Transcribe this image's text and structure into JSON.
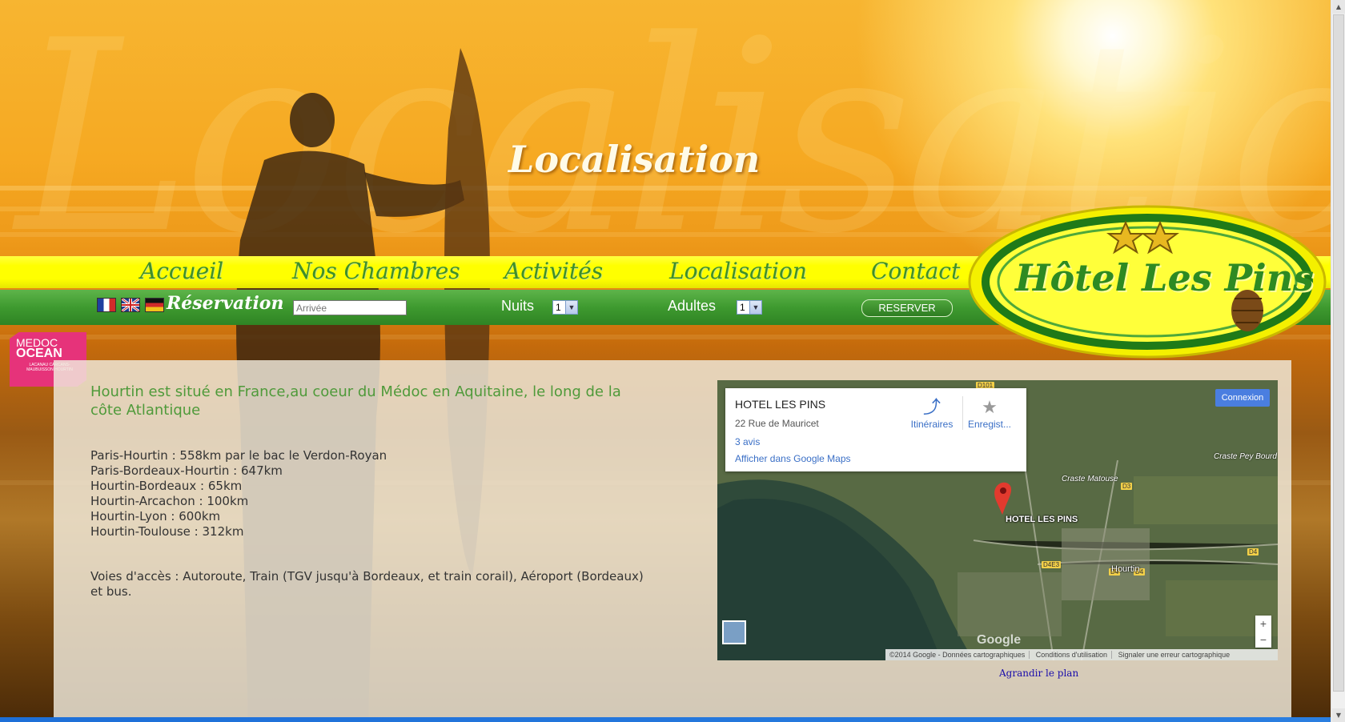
{
  "banner": {
    "title": "Localisation"
  },
  "nav": {
    "items": [
      "Accueil",
      "Nos Chambres",
      "Activités",
      "Localisation",
      "Contact"
    ]
  },
  "reservation": {
    "label": "Réservation",
    "arrival_placeholder": "Arrivée",
    "nights_label": "Nuits",
    "nights_value": "1",
    "adults_label": "Adultes",
    "adults_value": "1",
    "button": "RESERVER",
    "flags": [
      "fr-flag",
      "uk-flag",
      "de-flag"
    ]
  },
  "logo": {
    "text": "Hôtel Les Pins",
    "stars": 2
  },
  "badge": {
    "line1": "MEDOC",
    "line2": "OCEAN",
    "line3": "LACANAU CARCANS-MAUBUISSON HOURTIN"
  },
  "content": {
    "intro": "Hourtin est situé en France,au coeur du Médoc en Aquitaine, le long de la côte Atlantique",
    "distances": [
      "Paris-Hourtin : 558km par le bac le Verdon-Royan",
      "Paris-Bordeaux-Hourtin : 647km",
      "Hourtin-Bordeaux : 65km",
      "Hourtin-Arcachon : 100km",
      "Hourtin-Lyon : 600km",
      "Hourtin-Toulouse : 312km"
    ],
    "access": "Voies d'accès : Autoroute, Train (TGV jusqu'à Bordeaux, et train corail), Aéroport (Bordeaux) et bus."
  },
  "map": {
    "card_title": "HOTEL LES PINS",
    "card_address": "22 Rue de Mauricet",
    "card_reviews": "3 avis",
    "card_open": "Afficher dans Google Maps",
    "route_label": "Itinéraires",
    "save_label": "Enregist...",
    "connect_button": "Connexion",
    "pin_label": "HOTEL LES PINS",
    "town_label": "Hourtin",
    "labels": [
      "Craste Matouse",
      "Craste Pey Bourd"
    ],
    "roads": [
      "D3",
      "D4",
      "D4E3",
      "D4",
      "D4",
      "D101"
    ],
    "zoom_in": "+",
    "zoom_out": "−",
    "google": "Google",
    "footer": [
      "©2014 Google - Données cartographiques",
      "Conditions d'utilisation",
      "Signaler une erreur cartographique"
    ],
    "enlarge_link": "Agrandir le plan"
  }
}
